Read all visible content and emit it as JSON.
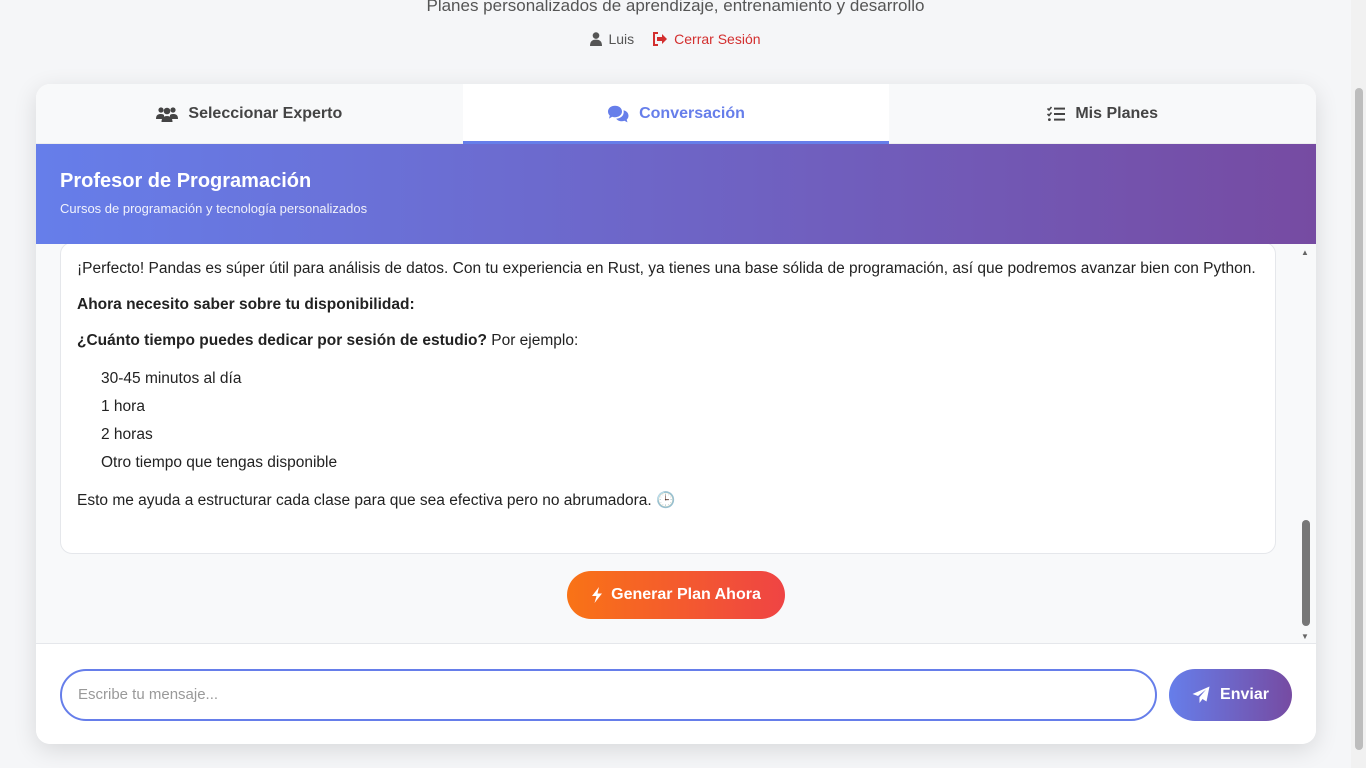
{
  "header": {
    "subtitle": "Planes personalizados de aprendizaje, entrenamiento y desarrollo",
    "user_name": "Luis",
    "logout_label": "Cerrar Sesión"
  },
  "tabs": [
    {
      "label": "Seleccionar Experto",
      "icon": "users-icon"
    },
    {
      "label": "Conversación",
      "icon": "comments-icon",
      "active": true
    },
    {
      "label": "Mis Planes",
      "icon": "list-check-icon"
    }
  ],
  "expert": {
    "name": "Profesor de Programación",
    "description": "Cursos de programación y tecnología personalizados"
  },
  "message": {
    "intro": "¡Perfecto! Pandas es súper útil para análisis de datos. Con tu experiencia en Rust, ya tienes una base sólida de programación, así que podremos avanzar bien con Python.",
    "availability_heading": "Ahora necesito saber sobre tu disponibilidad:",
    "question_bold": "¿Cuánto tiempo puedes dedicar por sesión de estudio?",
    "question_rest": " Por ejemplo:",
    "options": [
      "30-45 minutos al día",
      "1 hora",
      "2 horas",
      "Otro tiempo que tengas disponible"
    ],
    "closing": "Esto me ayuda a estructurar cada clase para que sea efectiva pero no abrumadora.",
    "closing_emoji": "🕒"
  },
  "generate_button": "Generar Plan Ahora",
  "input": {
    "placeholder": "Escribe tu mensaje...",
    "value": ""
  },
  "send_button": "Enviar",
  "colors": {
    "accent": "#667eea",
    "gradient_end": "#764ba2",
    "logout": "#d32f2f",
    "generate_start": "#f97316",
    "generate_end": "#ef4444"
  }
}
